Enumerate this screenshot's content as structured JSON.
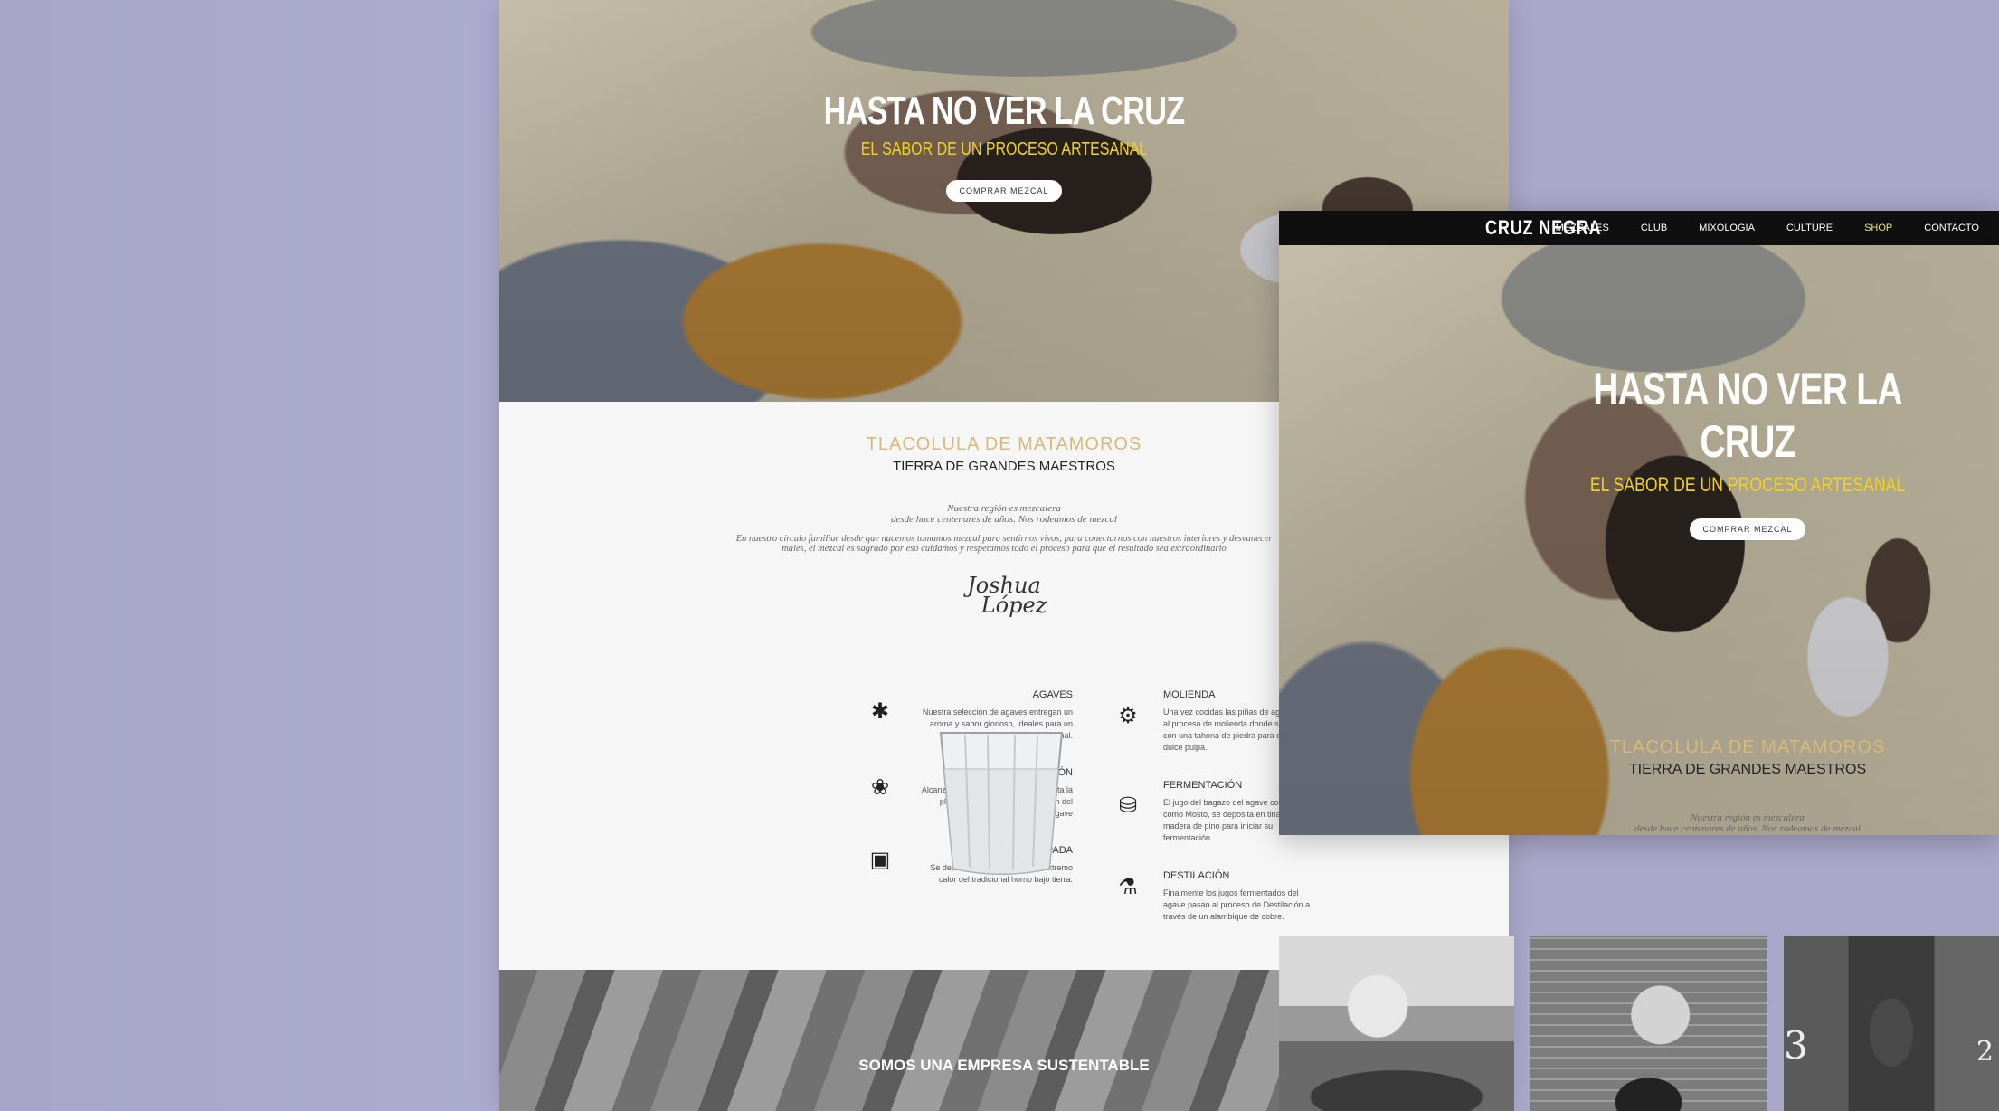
{
  "hero": {
    "title": "HASTA NO VER LA CRUZ",
    "subtitle": "EL SABOR DE UN PROCESO ARTESANAL",
    "button": "COMPRAR MEZCAL"
  },
  "intro": {
    "region": "TLACOLULA DE MATAMOROS",
    "tagline": "TIERRA DE GRANDES MAESTROS",
    "quote_line1": "Nuestra región es mezcalera",
    "quote_line2": "desde hace centenares de años. Nos rodeamos de mezcal",
    "para_line1": "En nuestro círculo familiar desde que nacemos tomamos mezcal para sentirnos vivos, para conectarnos con nuestros interiores y desvanecer",
    "para_line2": "males, el mezcal es sagrado por eso cuidamos y respetamos todo el proceso para que el resultado sea extraordinario",
    "signature_line1": "Joshua",
    "signature_line2": "López"
  },
  "process_left": [
    {
      "title": "AGAVES",
      "l1": "Nuestra selección de agaves entregan un",
      "l2": "aroma y sabor glorioso, ideales para un",
      "l3": "mezcal excepcional.",
      "icon": "agave-icon"
    },
    {
      "title": "EL CORAZÓN",
      "l1": "Alcanzando la maduración se despunta la",
      "l2": "planta, quedando solo el corazón del",
      "l3": "agave",
      "icon": "agave-heart-icon"
    },
    {
      "title": "TAPADA",
      "l1": "Se dejan las piñas de agave al extremo",
      "l2": "calor del tradicional horno bajo tierra.",
      "l3": "",
      "icon": "oven-icon"
    }
  ],
  "process_right": [
    {
      "title": "MOLIENDA",
      "l1": "Una vez cocidas las piñas de agave",
      "l2": "al proceso de molienda donde se",
      "l3": "con una tahona de piedra para ob",
      "l4": "dulce pulpa.",
      "icon": "mill-icon"
    },
    {
      "title": "FERMENTACIÓN",
      "l1": "El jugo del bagazo del agave conoc",
      "l2": "como Mosto, se deposita en tinas",
      "l3": "madera de pino para iniciar su",
      "l4": "fermentación.",
      "icon": "barrel-icon"
    },
    {
      "title": "DESTILACIÓN",
      "l1": "Finalmente los jugos fermentados del",
      "l2": "agave pasan al proceso de Destilación a",
      "l3": "través de un alambique de cobre.",
      "l4": "",
      "icon": "still-icon"
    }
  ],
  "sustainable": "SOMOS UNA EMPRESA SUSTENTABLE",
  "nav": {
    "logo": "CRUZ NEGRA",
    "items": [
      "MEZCALES",
      "CLUB",
      "MIXOLOGIA",
      "CULTURE",
      "SHOP",
      "CONTACTO"
    ]
  },
  "thumb_numbers": [
    "3",
    "2"
  ],
  "colors": {
    "background": "#a9a8c9",
    "accent_yellow": "#f1d21b",
    "gold": "#d9b97a",
    "nav": "#0f0f0f"
  }
}
